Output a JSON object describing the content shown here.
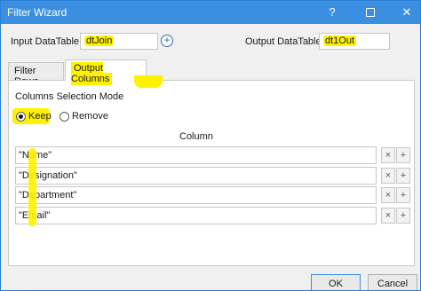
{
  "window": {
    "title": "Filter Wizard",
    "help_glyph": "?",
    "close_glyph": "✕"
  },
  "inputs": {
    "input_label": "Input DataTable",
    "input_value": "dtJoin",
    "output_label": "Output DataTable",
    "output_value": "dt1Out",
    "add_glyph": "+"
  },
  "tabs": [
    {
      "label": "Filter Rows",
      "active": false
    },
    {
      "label": "Output Columns",
      "active": true
    }
  ],
  "mode": {
    "label": "Columns Selection Mode",
    "options": [
      {
        "label": "Keep",
        "selected": true
      },
      {
        "label": "Remove",
        "selected": false
      }
    ]
  },
  "columns": {
    "header": "Column",
    "rows": [
      "\"Name\"",
      "\"Designation\"",
      "\"Department\"",
      "\"Email\""
    ],
    "remove_glyph": "×",
    "add_glyph": "+"
  },
  "footer": {
    "ok_label": "OK",
    "cancel_label": "Cancel"
  },
  "colors": {
    "titlebar": "#3a8fe0",
    "highlight": "#fff200"
  }
}
